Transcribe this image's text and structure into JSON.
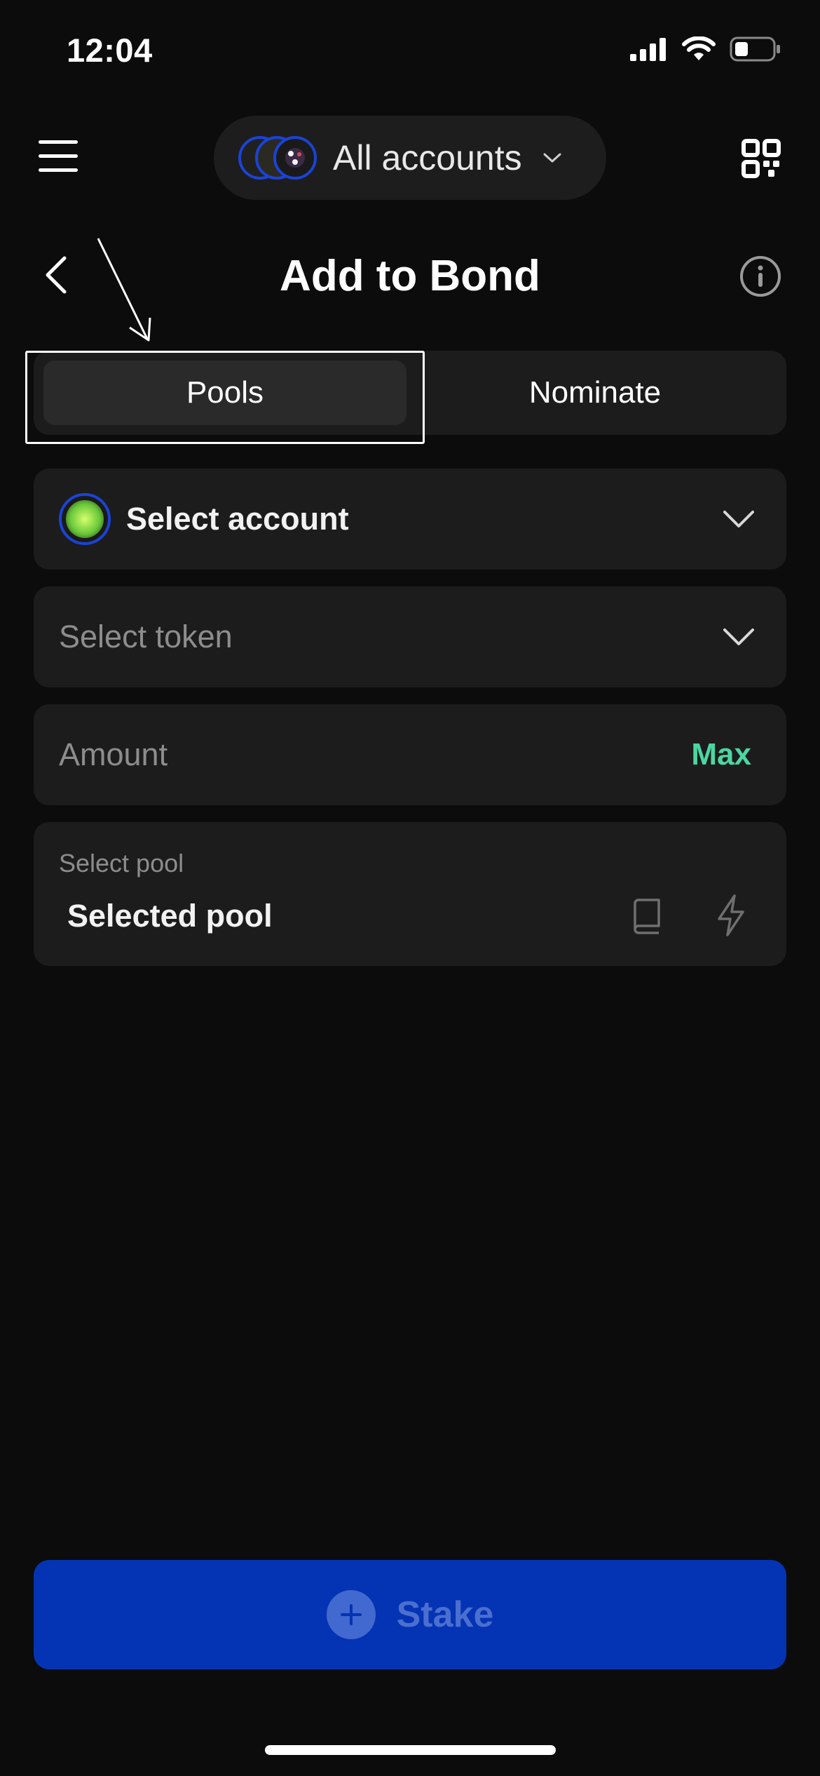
{
  "status_bar": {
    "time": "12:04",
    "icons": [
      "signal-icon",
      "wifi-icon",
      "battery-icon"
    ]
  },
  "header": {
    "menu_icon": "hamburger-menu-icon",
    "account_selector": {
      "label": "All accounts",
      "icon": "chevron-down-icon"
    },
    "qr_icon": "qr-code-icon"
  },
  "title_row": {
    "title": "Add to Bond",
    "back_icon": "chevron-left-icon",
    "info_icon": "info-icon"
  },
  "tabs": [
    {
      "label": "Pools",
      "active": true
    },
    {
      "label": "Nominate",
      "active": false
    }
  ],
  "form": {
    "account": {
      "label": "Select account"
    },
    "token": {
      "placeholder": "Select token"
    },
    "amount": {
      "placeholder": "Amount",
      "max_label": "Max"
    },
    "pool": {
      "caption": "Select pool",
      "value": "Selected pool",
      "icons": [
        "book-icon",
        "lightning-icon"
      ]
    }
  },
  "stake_button": {
    "label": "Stake",
    "icon": "plus-circle-icon"
  },
  "colors": {
    "background": "#0c0c0c",
    "card": "#1c1c1c",
    "accent_green": "#4cd6a2",
    "primary_blue": "#0433b3",
    "avatar_ring": "#1b43d6"
  }
}
